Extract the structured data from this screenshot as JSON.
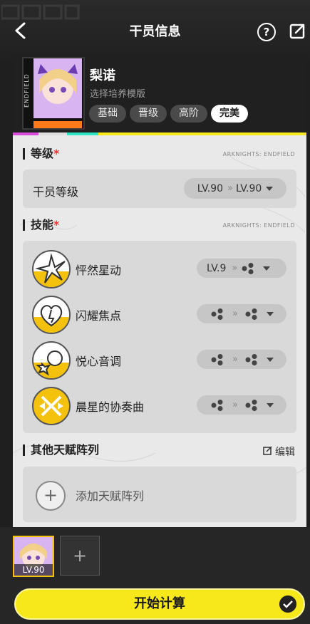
{
  "topbar": {
    "title": "干员信息",
    "back_icon": "chevron-left-icon",
    "help_label": "?",
    "share_icon": "external-link-icon"
  },
  "operator": {
    "name": "梨诺",
    "subtitle": "选择培养模版",
    "side_text": "ENDFIELD",
    "tabs": [
      {
        "label": "基础"
      },
      {
        "label": "晋级"
      },
      {
        "label": "高阶"
      },
      {
        "label": "完美"
      }
    ],
    "active_tab": 3
  },
  "level_section": {
    "title": "等级",
    "required_mark": "*",
    "brand": "ARKNIGHTS: ENDFIELD",
    "row_label": "干员等级",
    "from": "LV.90",
    "to": "LV.90",
    "arrows": "»"
  },
  "skill_section": {
    "title": "技能",
    "required_mark": "*",
    "brand": "ARKNIGHTS: ENDFIELD",
    "skills": [
      {
        "name": "怦然星动",
        "level": "LV.9",
        "icon": "starburst-skill-icon"
      },
      {
        "name": "闪耀焦点",
        "level": "",
        "icon": "heart-skill-icon"
      },
      {
        "name": "悦心音调",
        "level": "",
        "icon": "star-note-skill-icon"
      },
      {
        "name": "晨星的协奏曲",
        "level": "",
        "icon": "crossed-arrows-skill-icon"
      }
    ],
    "arrows": "»"
  },
  "talent_section": {
    "title": "其他天赋阵列",
    "edit_label": "编辑",
    "add_label": "添加天赋阵列",
    "add_symbol": "+"
  },
  "bottom": {
    "thumb_level": "LV.90",
    "add_slot_symbol": "+",
    "start_label": "开始计算"
  },
  "colors": {
    "accent": "#f7e81c",
    "skill_yellow": "#f4c20d",
    "header_bar": "#ff7a1a",
    "required": "#e33333"
  }
}
